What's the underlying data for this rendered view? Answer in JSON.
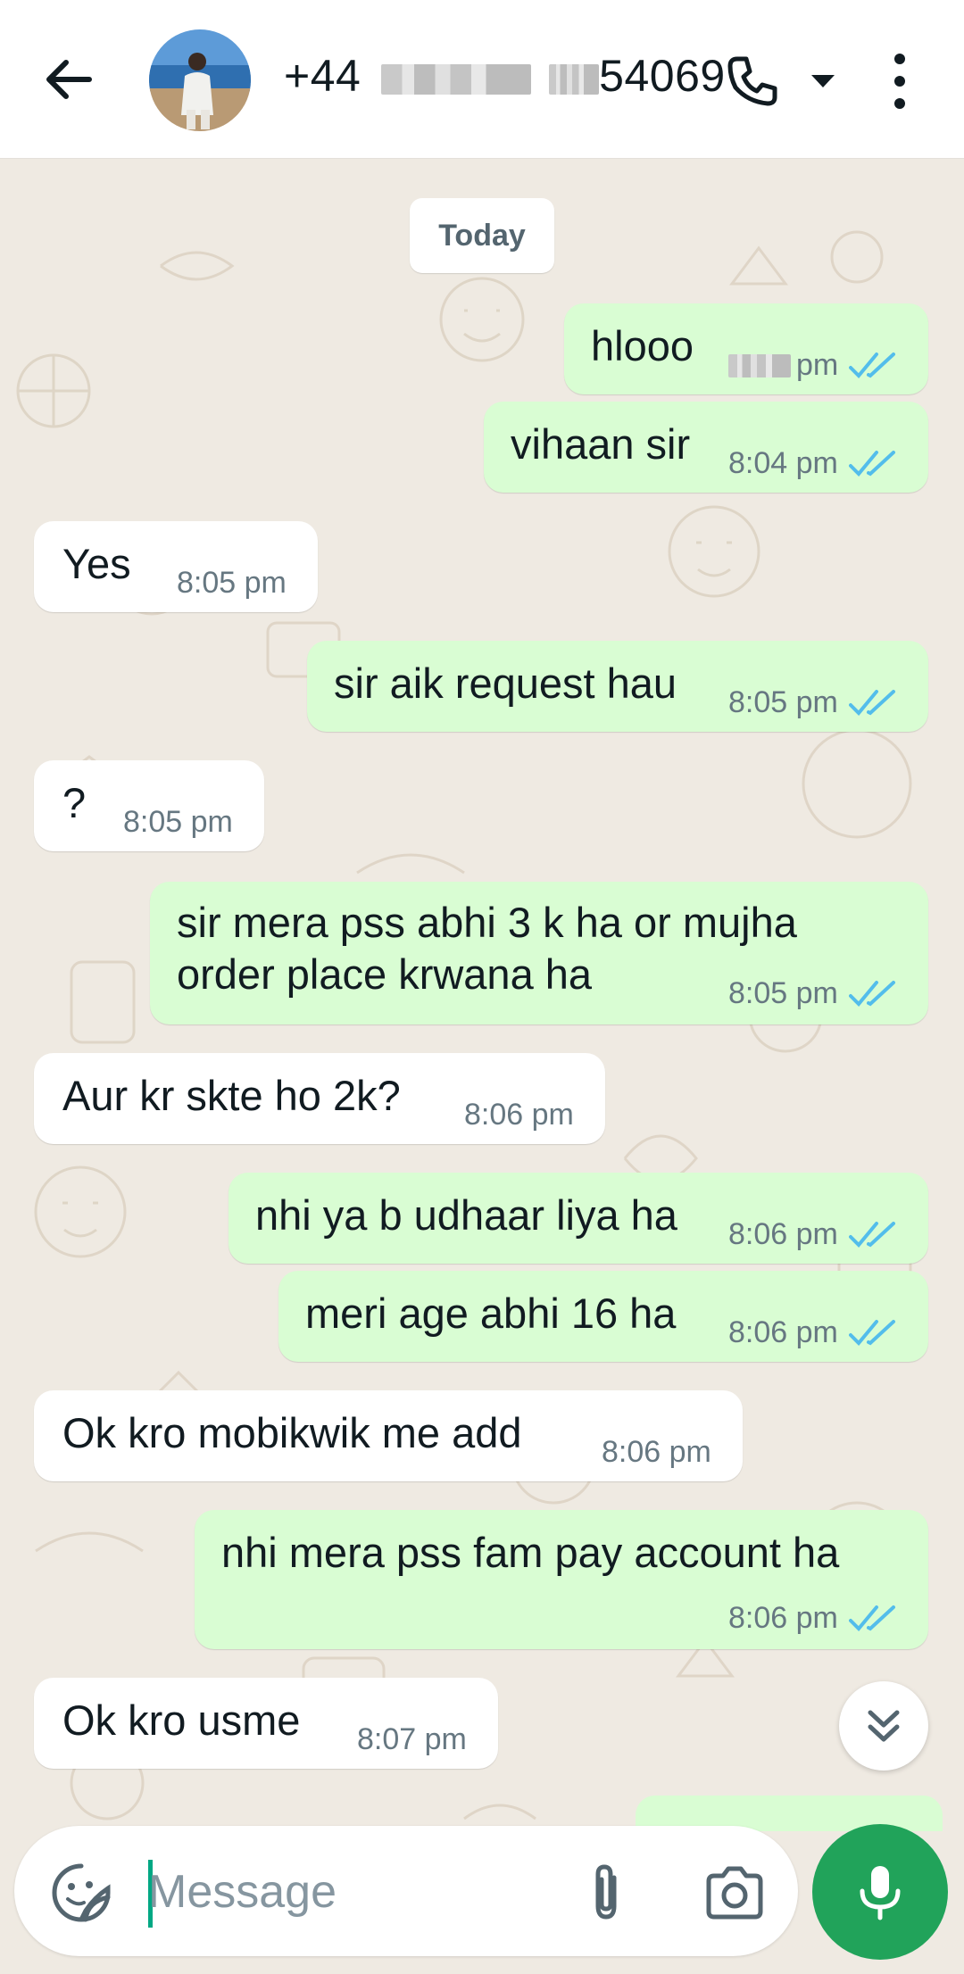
{
  "header": {
    "contact_prefix": "+44",
    "contact_suffix": "54069",
    "accent_color": "#21a35a"
  },
  "chat": {
    "date_label": "Today",
    "messages": [
      {
        "dir": "out",
        "text": "hlooo",
        "time": "pm",
        "status": "read"
      },
      {
        "dir": "out",
        "text": "vihaan sir",
        "time": "8:04 pm",
        "status": "read"
      },
      {
        "dir": "in",
        "text": "Yes",
        "time": "8:05 pm"
      },
      {
        "dir": "out",
        "text": "sir aik request hau",
        "time": "8:05 pm",
        "status": "read"
      },
      {
        "dir": "in",
        "text": "?",
        "time": "8:05 pm"
      },
      {
        "dir": "out",
        "text": "sir mera pss abhi 3 k ha or mujha",
        "text2": "order place krwana ha",
        "time": "8:05 pm",
        "status": "read"
      },
      {
        "dir": "in",
        "text": "Aur kr skte ho 2k?",
        "time": "8:06 pm"
      },
      {
        "dir": "out",
        "text": "nhi ya b udhaar liya ha",
        "time": "8:06 pm",
        "status": "read"
      },
      {
        "dir": "out",
        "text": "meri age abhi 16 ha",
        "time": "8:06 pm",
        "status": "read"
      },
      {
        "dir": "in",
        "text": "Ok kro mobikwik me add",
        "time": "8:06 pm"
      },
      {
        "dir": "out",
        "text": "nhi mera pss fam pay account ha",
        "time": "8:06 pm",
        "status": "read"
      },
      {
        "dir": "in",
        "text": "Ok kro usme",
        "time": "8:07 pm"
      }
    ]
  },
  "composer": {
    "placeholder": "Message"
  },
  "icons": {
    "back": "arrow-left-icon",
    "call": "phone-icon",
    "call_dropdown": "caret-down-icon",
    "menu": "more-vert-icon",
    "scroll": "double-chevron-down-icon",
    "emoji": "sticker-icon",
    "attach": "paperclip-icon",
    "camera": "camera-icon",
    "mic": "mic-icon"
  }
}
